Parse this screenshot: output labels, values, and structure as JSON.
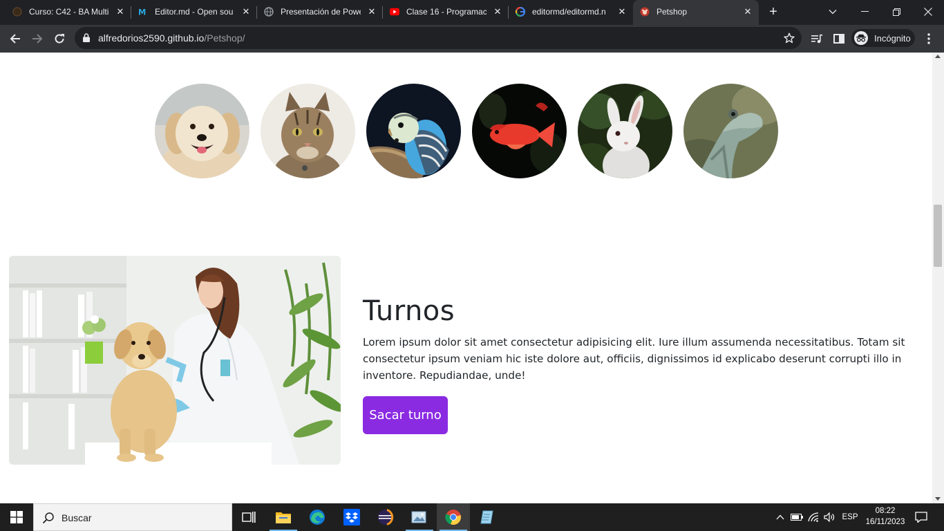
{
  "browser": {
    "tabs": [
      {
        "title": "Curso: C42 - BA Multi",
        "icon": "course-icon",
        "active": false
      },
      {
        "title": "Editor.md - Open sou",
        "icon": "editormd-icon",
        "active": false
      },
      {
        "title": "Presentación de Powe",
        "icon": "globe-icon",
        "active": false
      },
      {
        "title": "Clase 16 - Programac",
        "icon": "youtube-icon",
        "active": false
      },
      {
        "title": "editormd/editormd.n",
        "icon": "google-icon",
        "active": false
      },
      {
        "title": "Petshop",
        "icon": "petshop-icon",
        "active": true
      }
    ],
    "url": {
      "host": "alfredorios2590.github.io",
      "path": "/Petshop/"
    },
    "incognito_label": "Incógnito"
  },
  "page": {
    "pets": [
      {
        "name": "dog"
      },
      {
        "name": "cat"
      },
      {
        "name": "parakeet"
      },
      {
        "name": "fish"
      },
      {
        "name": "rabbit"
      },
      {
        "name": "lizard"
      }
    ],
    "turnos": {
      "title": "Turnos",
      "text": "Lorem ipsum dolor sit amet consectetur adipisicing elit. Iure illum assumenda necessitatibus. Totam sit consectetur ipsum veniam hic iste dolore aut, officiis, dignissimos id explicabo deserunt corrupti illo in inventore. Repudiandae, unde!",
      "button_label": "Sacar turno",
      "button_color": "#8a2be2"
    }
  },
  "taskbar": {
    "search_placeholder": "Buscar",
    "apps": [
      "task-view-icon",
      "file-explorer-icon",
      "edge-icon",
      "dropbox-icon",
      "eclipse-icon",
      "photos-icon",
      "chrome-icon",
      "notepad-icon"
    ],
    "language": "ESP",
    "time": "08:22",
    "date": "16/11/2023"
  }
}
